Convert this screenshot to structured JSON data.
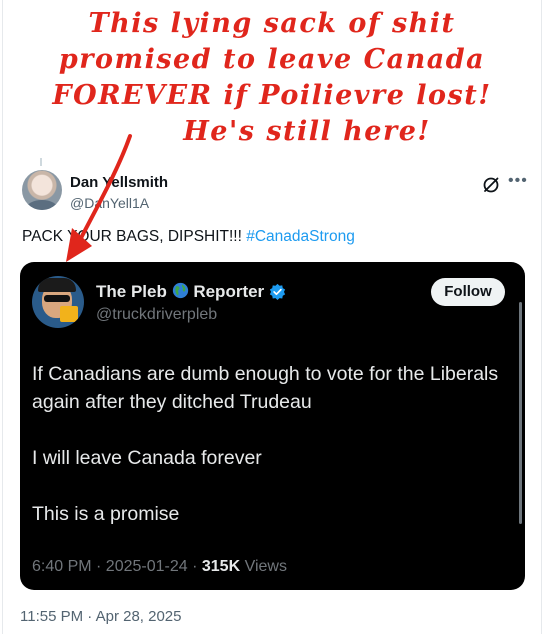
{
  "annotation": {
    "lines": [
      "This lying sack of shit",
      "promised to leave Canada",
      "FOREVER if Poilievre lost!",
      "He's still here!"
    ],
    "color": "#e0261c"
  },
  "post": {
    "author_name": "Dan Yellsmith",
    "author_handle": "@DanYell1A",
    "text": "PACK YOUR BAGS, DIPSHIT!!!",
    "hashtag": "#CanadaStrong",
    "timestamp": "11:55 PM · Apr 28, 2025",
    "icons": [
      "grok-icon",
      "more-icon"
    ]
  },
  "quote": {
    "name_part1": "The Pleb",
    "name_part2": "Reporter",
    "handle": "@truckdriverpleb",
    "follow_label": "Follow",
    "body": [
      "If Canadians are dumb enough to vote for the Liberals again after they ditched Trudeau",
      "I will leave Canada forever",
      "This is a promise"
    ],
    "meta_time": "6:40 PM · 2025-01-24 · ",
    "views_count": "315K",
    "views_label": " Views",
    "icons": [
      "globe-icon",
      "verified-icon"
    ]
  },
  "colors": {
    "link": "#1d9bf0",
    "card_bg": "#000000",
    "verified": "#1d9bf0"
  }
}
